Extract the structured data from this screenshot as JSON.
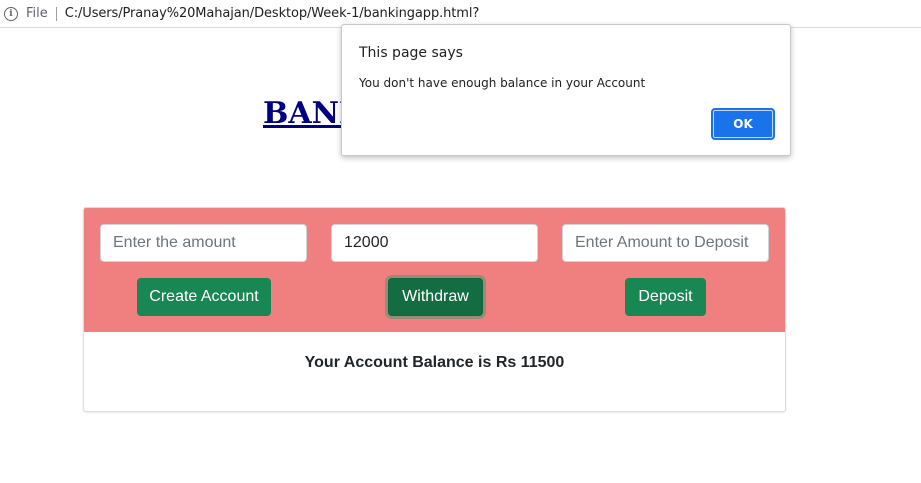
{
  "browser": {
    "scheme": "File",
    "url": "C:/Users/Pranay%20Mahajan/Desktop/Week-1/bankingapp.html?",
    "info_icon": "info-icon"
  },
  "page": {
    "title_visible": "BANK"
  },
  "form": {
    "amount_input": {
      "placeholder": "Enter the amount",
      "value": ""
    },
    "withdraw_input": {
      "placeholder": "",
      "value": "12000"
    },
    "deposit_input": {
      "placeholder": "Enter Amount to Deposit",
      "value": ""
    },
    "create_account_label": "Create Account",
    "withdraw_label": "Withdraw",
    "deposit_label": "Deposit"
  },
  "balance_text": "Your Account Balance is Rs 11500",
  "dialog": {
    "title": "This page says",
    "message": "You don't have enough balance in your Account",
    "ok_label": "OK"
  },
  "colors": {
    "panel": "#f08080",
    "button": "#198754",
    "title": "#000080",
    "ok": "#1a73e8"
  }
}
